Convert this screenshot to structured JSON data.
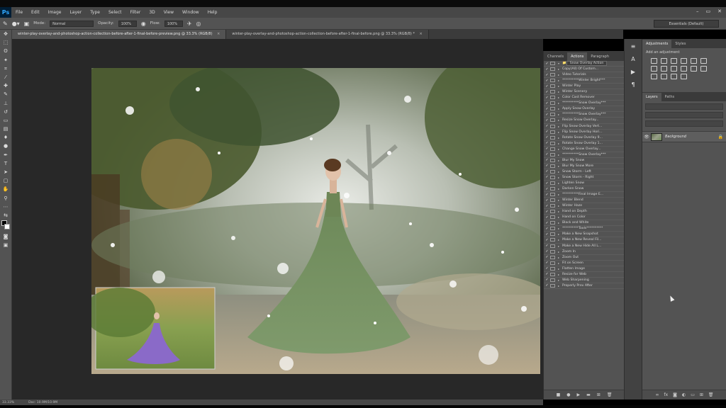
{
  "app": {
    "logo": "Ps"
  },
  "menu": [
    "File",
    "Edit",
    "Image",
    "Layer",
    "Type",
    "Select",
    "Filter",
    "3D",
    "View",
    "Window",
    "Help"
  ],
  "window_controls": [
    "–",
    "▭",
    "✕"
  ],
  "options_bar": {
    "mode_label": "Mode:",
    "mode_value": "Normal",
    "opacity_label": "Opacity:",
    "opacity_value": "100%",
    "flow_label": "Flow:",
    "flow_value": "100%",
    "workspace": "Essentials (Default)"
  },
  "tabs": [
    {
      "label": "winter-play-overlay-and-photoshop-action-collection-before-after-1-final-before-preview.png @ 33.3% (RGB/8)",
      "active": true
    },
    {
      "label": "winter-play-overlay-and-photoshop-action-collection-before-after-1-final-before.png @ 33.3% (RGB/8) *",
      "active": false
    }
  ],
  "actions_panel": {
    "tabs": [
      "Channels",
      "Actions",
      "Paragraph"
    ],
    "active_tab": "Actions",
    "items": [
      "Snow Overlay Action",
      "Copy(All) Of Custom...",
      "Video Tutorials",
      "**********Winter Bright***",
      "Winter Play",
      "Winter Scenery",
      "Color Cast Remover",
      "**********Snow Overlay***",
      "Apply Snow Overlay",
      "**********Snow Overlay***",
      "Resize Snow Overlay...",
      "Flip Snow Overlay Vert...",
      "Flip Snow Overlay Hori...",
      "Rotate Snow Overlay 9...",
      "Rotate Snow Overlay 1...",
      "Change Snow Overlay...",
      "**********Snow Overlay***",
      "Blur My Snow",
      "Blur My Snow More",
      "Snow Storm - Left",
      "Snow Storm - Right",
      "Lighten Snow",
      "Darken Snow",
      "**********Final Image E...",
      "Winter Blend",
      "Winter Haze",
      "Hand on Depth",
      "Hand on Color",
      "Black and White",
      "**********Tools**********",
      "Make a New Snapshot",
      "Make a New Reveal Fil...",
      "Make a New Hide All L...",
      "Zoom In",
      "Zoom Out",
      "Fit on Screen",
      "Flatten Image",
      "Resize for Web",
      "Web Sharpening",
      "Properly Prev After"
    ]
  },
  "right_panels": {
    "adjust_tabs": [
      "Adjustments",
      "Styles"
    ],
    "adjust_subtitle": "Add an adjustment",
    "layers_tabs": [
      "Layers",
      "Paths"
    ],
    "layer_name": "Background"
  },
  "status": {
    "zoom": "33.33%",
    "doc": "Doc: 10.9M/10.9M"
  }
}
